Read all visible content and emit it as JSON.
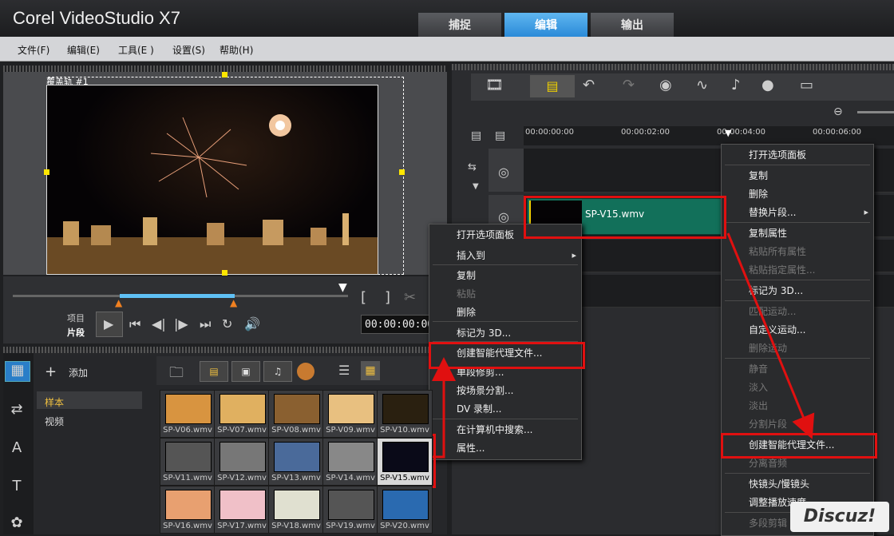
{
  "app": {
    "title": "Corel VideoStudio X7"
  },
  "tabs": [
    {
      "label": "捕捉"
    },
    {
      "label": "编辑"
    },
    {
      "label": "输出"
    }
  ],
  "menu": [
    {
      "label": "文件(F)"
    },
    {
      "label": "编辑(E)"
    },
    {
      "label": "工具(E )"
    },
    {
      "label": "设置(S)"
    },
    {
      "label": "帮助(H)"
    }
  ],
  "preview": {
    "overlay_label": "覆盖轨 #1"
  },
  "transport": {
    "project_label": "项目",
    "clip_label": "片段",
    "timecode": "00:00:00:00"
  },
  "library": {
    "add_label": "添加",
    "categories": [
      {
        "label": "样本"
      },
      {
        "label": "视频"
      }
    ],
    "items": [
      {
        "label": "SP-V06.wmv"
      },
      {
        "label": "SP-V07.wmv"
      },
      {
        "label": "SP-V08.wmv"
      },
      {
        "label": "SP-V09.wmv"
      },
      {
        "label": "SP-V10.wmv"
      },
      {
        "label": "SP-V11.wmv"
      },
      {
        "label": "SP-V12.wmv"
      },
      {
        "label": "SP-V13.wmv"
      },
      {
        "label": "SP-V14.wmv"
      },
      {
        "label": "SP-V15.wmv"
      },
      {
        "label": "SP-V16.wmv"
      },
      {
        "label": "SP-V17.wmv"
      },
      {
        "label": "SP-V18.wmv"
      },
      {
        "label": "SP-V19.wmv"
      },
      {
        "label": "SP-V20.wmv"
      }
    ]
  },
  "timeline": {
    "ruler": [
      "00:00:00:00",
      "00:00:02:00",
      "00:00:04:00",
      "00:00:06:00"
    ],
    "clip_label": "SP-V15.wmv"
  },
  "context_menu_library": {
    "items": [
      {
        "label": "打开选项面板"
      },
      {
        "label": "插入到"
      },
      {
        "label": "复制"
      },
      {
        "label": "粘贴"
      },
      {
        "label": "删除"
      },
      {
        "label": "标记为 3D..."
      },
      {
        "label": "创建智能代理文件..."
      },
      {
        "label": "单段修剪..."
      },
      {
        "label": "按场景分割..."
      },
      {
        "label": "DV 录制..."
      },
      {
        "label": "在计算机中搜索..."
      },
      {
        "label": "属性..."
      }
    ]
  },
  "context_menu_timeline": {
    "items": [
      {
        "label": "打开选项面板"
      },
      {
        "label": "复制"
      },
      {
        "label": "删除"
      },
      {
        "label": "替换片段..."
      },
      {
        "label": "复制属性"
      },
      {
        "label": "粘贴所有属性"
      },
      {
        "label": "粘贴指定属性..."
      },
      {
        "label": "标记为 3D..."
      },
      {
        "label": "匹配运动..."
      },
      {
        "label": "自定义运动..."
      },
      {
        "label": "删除运动"
      },
      {
        "label": "静音"
      },
      {
        "label": "淡入"
      },
      {
        "label": "淡出"
      },
      {
        "label": "分割片段"
      },
      {
        "label": "创建智能代理文件..."
      },
      {
        "label": "分离音频"
      },
      {
        "label": "快镜头/慢镜头"
      },
      {
        "label": "调整播放速度..."
      },
      {
        "label": "多段剪辑"
      }
    ]
  },
  "watermark": {
    "text": "Discuz!"
  },
  "colors": {
    "accent": "#3a9ee8",
    "highlight": "#e01010",
    "clip": "#12705a"
  }
}
